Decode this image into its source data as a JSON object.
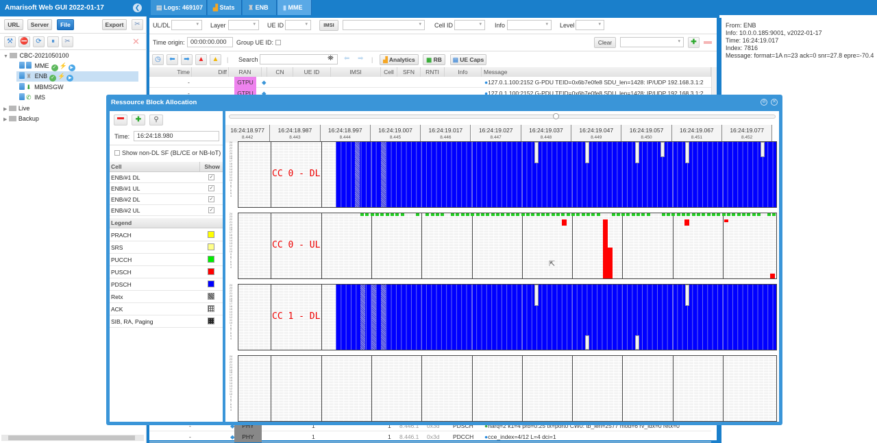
{
  "app": {
    "title": "Amarisoft Web GUI 2022-01-17"
  },
  "sidebar": {
    "buttons": [
      "URL",
      "Server",
      "File",
      "Export"
    ],
    "active_button": "File",
    "tree": {
      "root": "CBC-2021050100",
      "children": [
        {
          "label": "MME",
          "status": [
            "ok",
            "bolt",
            "play"
          ]
        },
        {
          "label": "ENB",
          "status": [
            "ok",
            "bolt",
            "play"
          ],
          "selected": true
        },
        {
          "label": "MBMSGW"
        },
        {
          "label": "IMS"
        }
      ],
      "folders": [
        "Live",
        "Backup"
      ]
    }
  },
  "tabs": [
    {
      "label": "Logs: 469107",
      "icon": "document-icon"
    },
    {
      "label": "Stats",
      "icon": "chart-icon"
    },
    {
      "label": "ENB",
      "icon": "antenna-icon"
    },
    {
      "label": "MME",
      "icon": "server-icon"
    }
  ],
  "filters": {
    "uldl_label": "UL/DL",
    "layer_label": "Layer",
    "ueid_label": "UE ID",
    "imsi_button": "IMSI",
    "cellid_label": "Cell ID",
    "info_label": "Info",
    "level_label": "Level",
    "time_origin_label": "Time origin:",
    "time_origin_value": "00:00:00.000",
    "group_ue_label": "Group UE ID:",
    "clear_button": "Clear",
    "search_label": "Search",
    "analytics_button": "Analytics",
    "rb_button": "RB",
    "uecaps_button": "UE Caps"
  },
  "log_table": {
    "columns": [
      "Time",
      "Diff",
      "RAN",
      "CN",
      "UE ID",
      "IMSI",
      "Cell",
      "SFN",
      "RNTI",
      "Info",
      "Message"
    ],
    "rows_top": [
      {
        "time": "-",
        "ran": "GTPU",
        "message": "127.0.1.100:2152 G-PDU TEID=0x6b7e0fe8 SDU_len=1428: IP/UDP 192.168.3.1:2"
      },
      {
        "time": "-",
        "ran": "GTPU",
        "message": "127.0.1.100:2152 G-PDU TEID=0x6b7e0fe8 SDU_len=1428: IP/UDP 192.168.3.1:2"
      }
    ],
    "rows_bottom": [
      {
        "time": "-",
        "ran": "PHY",
        "ueid": "1",
        "cell": "1",
        "sfn": "8.446.1",
        "rnti": "0x3d",
        "info": "PDSCH",
        "message": "harq=2 k1=4 prb=0:25 tx=port0 CW0: tb_len=2577 mod=6 rv_idx=0 retx=0"
      },
      {
        "time": "-",
        "ran": "PHY",
        "ueid": "1",
        "cell": "1",
        "sfn": "8.446.1",
        "rnti": "0x3d",
        "info": "PDCCH",
        "message": "cce_index=4/12 L=4 dci=1"
      }
    ]
  },
  "info_panel": {
    "lines": [
      "From: ENB",
      "Info: 10.0.0.185:9001, v2022-01-17",
      "Time: 16:24:19.017",
      "Index: 7816",
      "Message: format=1A n=23 ack=0 snr=27.8 epre=-70.4"
    ]
  },
  "rb_dialog": {
    "title": "Ressource Block Allocation",
    "time_label": "Time:",
    "time_value": "16:24:18.980",
    "show_non_dl_label": "Show non-DL SF (BL/CE or NB-IoT)",
    "cell_header": "Cell",
    "show_header": "Show",
    "cells": [
      {
        "name": "ENB/#1 DL",
        "show": true
      },
      {
        "name": "ENB/#1 UL",
        "show": true
      },
      {
        "name": "ENB/#2 DL",
        "show": true
      },
      {
        "name": "ENB/#2 UL",
        "show": true
      }
    ],
    "legend_header": "Legend",
    "legend": [
      {
        "name": "PRACH",
        "color": "#ffff00"
      },
      {
        "name": "SRS",
        "color": "#ffff88"
      },
      {
        "name": "PUCCH",
        "color": "#00ee00"
      },
      {
        "name": "PUSCH",
        "color": "#ff0000"
      },
      {
        "name": "PDSCH",
        "color": "#0000ff"
      },
      {
        "name": "Retx",
        "color": "pattern-diagonal"
      },
      {
        "name": "ACK",
        "color": "pattern-grid"
      },
      {
        "name": "SIB, RA, Paging",
        "color": "pattern-dots"
      }
    ],
    "timeline": [
      {
        "time": "16:24:18.977",
        "sf": "8.442"
      },
      {
        "time": "16:24:18.987",
        "sf": "8.443"
      },
      {
        "time": "16:24:18.997",
        "sf": "8.444"
      },
      {
        "time": "16:24:19.007",
        "sf": "8.445"
      },
      {
        "time": "16:24:19.017",
        "sf": "8.446"
      },
      {
        "time": "16:24:19.027",
        "sf": "8.447"
      },
      {
        "time": "16:24:19.037",
        "sf": "8.448"
      },
      {
        "time": "16:24:19.047",
        "sf": "8.449"
      },
      {
        "time": "16:24:19.057",
        "sf": "8.450"
      },
      {
        "time": "16:24:19.067",
        "sf": "8.451"
      },
      {
        "time": "16:24:19.077",
        "sf": "8.452"
      }
    ],
    "panels": [
      {
        "label": "CC 0 - DL"
      },
      {
        "label": "CC 0 - UL"
      },
      {
        "label": "CC 1 - DL"
      },
      {
        "label": ""
      }
    ],
    "rb_range": [
      0,
      24
    ]
  }
}
